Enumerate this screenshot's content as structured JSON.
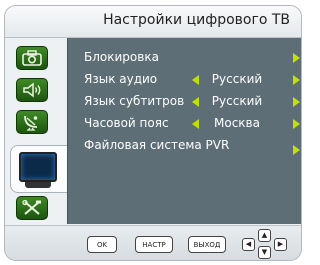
{
  "window": {
    "title": "Настройки цифрового ТВ"
  },
  "tabs": [
    {
      "icon": "camera-icon"
    },
    {
      "icon": "speaker-icon"
    },
    {
      "icon": "satellite-dish-icon"
    },
    {
      "icon": "tv-screen-icon",
      "selected": true
    },
    {
      "icon": "tools-icon"
    }
  ],
  "menu": {
    "items": [
      {
        "label": "Блокировка",
        "value": ""
      },
      {
        "label": "Язык аудио",
        "value": "Русский"
      },
      {
        "label": "Язык субтитров",
        "value": "Русский"
      },
      {
        "label": "Часовой пояс",
        "value": "Москва"
      },
      {
        "label": "Файловая система PVR",
        "value": ""
      }
    ]
  },
  "footer": {
    "ok_label": "OK",
    "setup_label": "НАСТР",
    "exit_label": "ВЫХОД"
  },
  "colors": {
    "panel_bg": "#5d6e76",
    "accent_arrow": "#c4e000",
    "tab_green": "#2f6e1b"
  }
}
